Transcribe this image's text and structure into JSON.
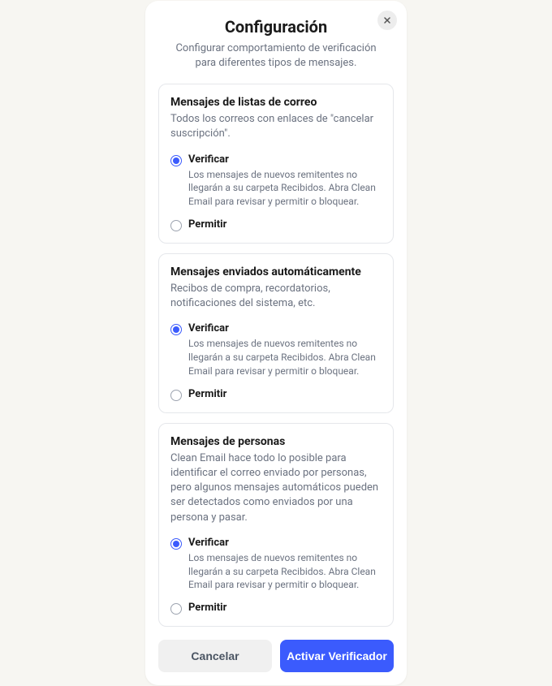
{
  "modal": {
    "title": "Configuración",
    "subtitle": "Configurar comportamiento de verificación para diferentes tipos de mensajes."
  },
  "sections": [
    {
      "title": "Mensajes de listas de correo",
      "desc": "Todos los correos con enlaces de \"cancelar suscripción\".",
      "options": [
        {
          "label": "Verificar",
          "desc": "Los mensajes de nuevos remitentes no llegarán a su carpeta Recibidos. Abra Clean Email para revisar y permitir o bloquear.",
          "selected": true
        },
        {
          "label": "Permitir",
          "desc": "",
          "selected": false
        }
      ]
    },
    {
      "title": "Mensajes enviados automáticamente",
      "desc": "Recibos de compra, recordatorios, notificaciones del sistema, etc.",
      "options": [
        {
          "label": "Verificar",
          "desc": "Los mensajes de nuevos remitentes no llegarán a su carpeta Recibidos. Abra Clean Email para revisar y permitir o bloquear.",
          "selected": true
        },
        {
          "label": "Permitir",
          "desc": "",
          "selected": false
        }
      ]
    },
    {
      "title": "Mensajes de personas",
      "desc": "Clean Email hace todo lo posible para identificar el correo enviado por personas, pero algunos mensajes automáticos pueden ser detectados como enviados por una persona y pasar.",
      "options": [
        {
          "label": "Verificar",
          "desc": "Los mensajes de nuevos remitentes no llegarán a su carpeta Recibidos. Abra Clean Email para revisar y permitir o bloquear.",
          "selected": true
        },
        {
          "label": "Permitir",
          "desc": "",
          "selected": false
        }
      ]
    }
  ],
  "buttons": {
    "cancel": "Cancelar",
    "activate": "Activar Verificador"
  }
}
